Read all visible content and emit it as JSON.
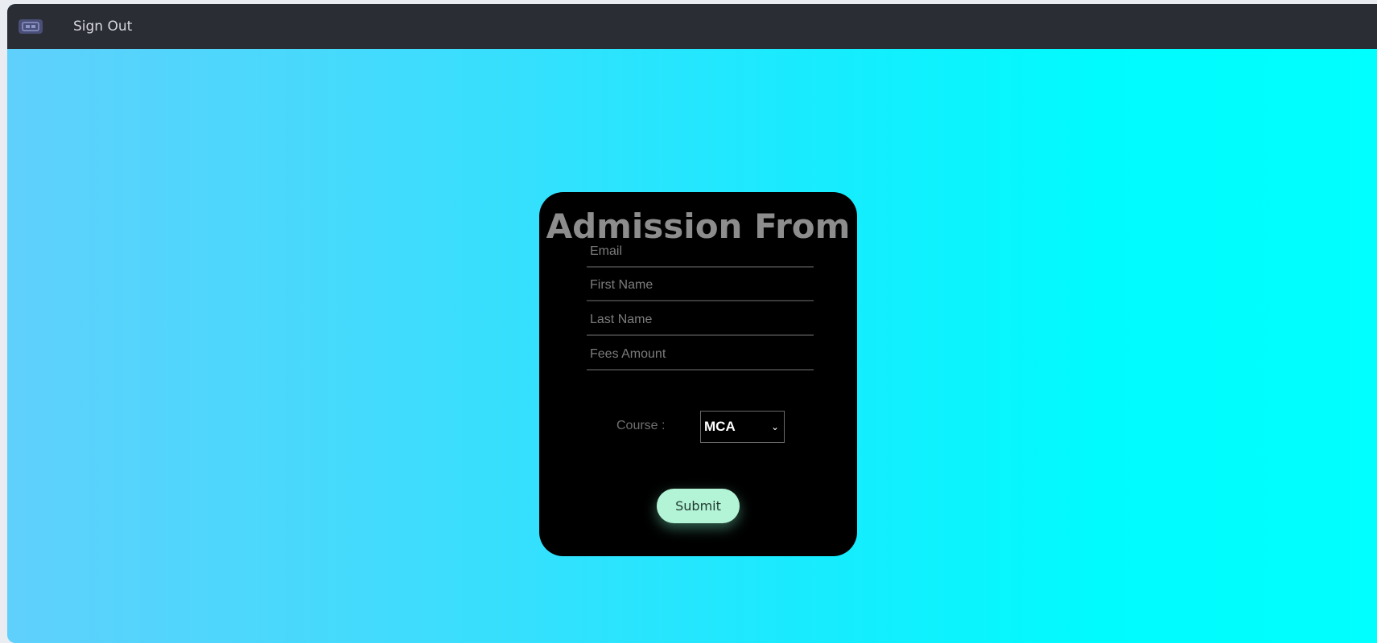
{
  "topbar": {
    "logo_icon": "app-logo-icon",
    "signout_label": "Sign Out"
  },
  "form": {
    "title": "Admission From",
    "fields": [
      {
        "name": "email",
        "placeholder": "Email",
        "value": ""
      },
      {
        "name": "first_name",
        "placeholder": "First Name",
        "value": ""
      },
      {
        "name": "last_name",
        "placeholder": "Last Name",
        "value": ""
      },
      {
        "name": "fees_amount",
        "placeholder": "Fees Amount",
        "value": ""
      }
    ],
    "course_label": "Course :",
    "course_selected": "MCA",
    "submit_label": "Submit"
  },
  "colors": {
    "topbar_bg": "#2a2d33",
    "card_bg": "#000000",
    "submit_bg": "#b3f3d6",
    "gradient_start": "#5fd0fb",
    "gradient_end": "#00ffff"
  }
}
